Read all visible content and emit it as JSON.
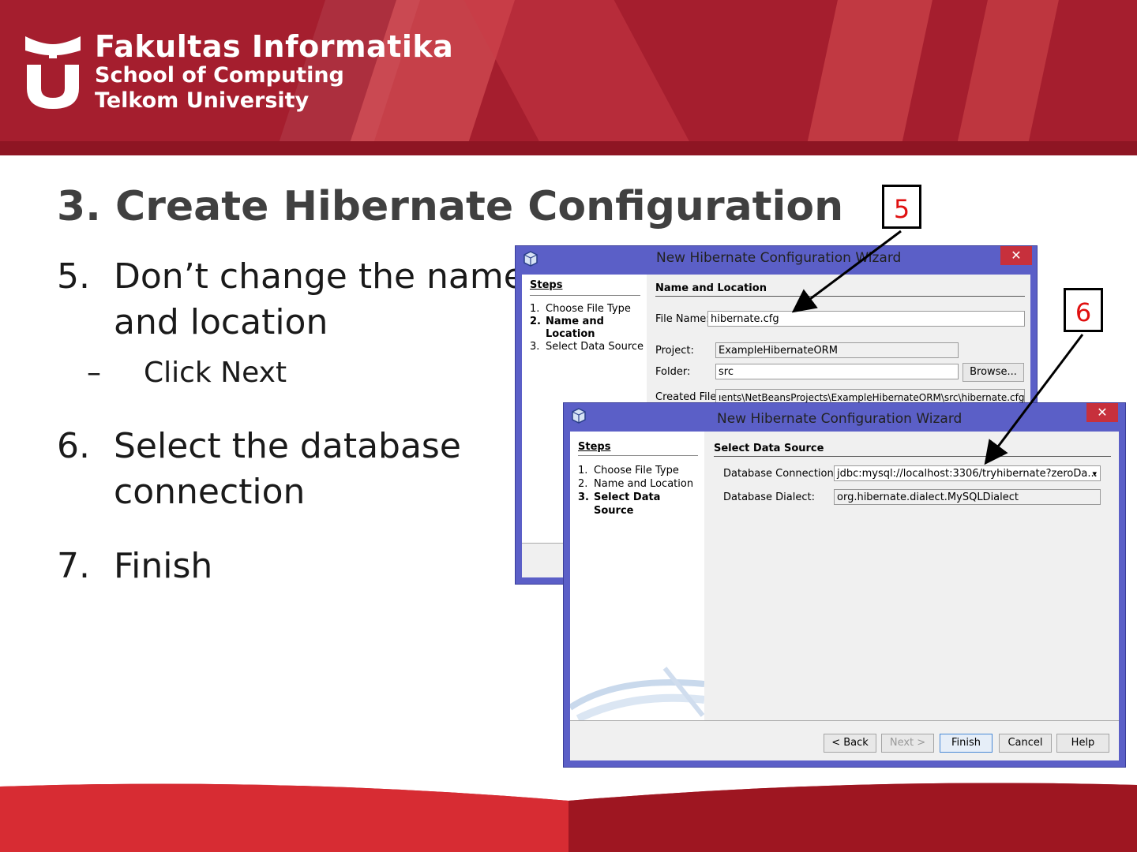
{
  "banner": {
    "brand_line1": "Fakultas Informatika",
    "brand_line2": "School of Computing",
    "brand_line3": "Telkom University"
  },
  "slide": {
    "title_num": "3.",
    "title": "Create Hibernate Configuration",
    "items": [
      {
        "num": "5.",
        "line1": "Don’t change the name",
        "line2": "and location"
      },
      {
        "num": "6.",
        "line1": "Select the database",
        "line2": "connection"
      },
      {
        "num": "7.",
        "line1": "Finish"
      }
    ],
    "sub": {
      "dash": "–",
      "text": "Click Next"
    }
  },
  "callouts": {
    "a": "5",
    "b": "6"
  },
  "dialog_back": {
    "title": "New Hibernate Configuration Wizard",
    "close": "✕",
    "steps_header": "Steps",
    "steps": [
      {
        "n": "1.",
        "label": "Choose File Type"
      },
      {
        "n": "2.",
        "label": "Name and"
      },
      {
        "n": "",
        "label": "Location"
      },
      {
        "n": "3.",
        "label": "Select Data Source"
      }
    ],
    "section": "Name and Location",
    "file_name_label": "File Name:",
    "file_name_value": "hibernate.cfg",
    "project_label": "Project:",
    "project_value": "ExampleHibernateORM",
    "folder_label": "Folder:",
    "folder_value": "src",
    "browse_label": "Browse...",
    "created_label": "Created File:",
    "created_value": "ıents\\NetBeansProjects\\ExampleHibernateORM\\src\\hibernate.cfg.xml"
  },
  "dialog_front": {
    "title": "New Hibernate Configuration Wizard",
    "close": "✕",
    "steps_header": "Steps",
    "steps": [
      {
        "n": "1.",
        "label": "Choose File Type"
      },
      {
        "n": "2.",
        "label": "Name and Location"
      },
      {
        "n": "3.",
        "label": "Select Data"
      },
      {
        "n": "",
        "label": "Source"
      }
    ],
    "section": "Select Data Source",
    "conn_label": "Database Connection:",
    "conn_value": "jdbc:mysql://localhost:3306/tryhibernate?zeroDa...",
    "dialect_label": "Database Dialect:",
    "dialect_value": "org.hibernate.dialect.MySQLDialect",
    "buttons": {
      "back": "< Back",
      "next": "Next >",
      "finish": "Finish",
      "cancel": "Cancel",
      "help": "Help"
    }
  }
}
